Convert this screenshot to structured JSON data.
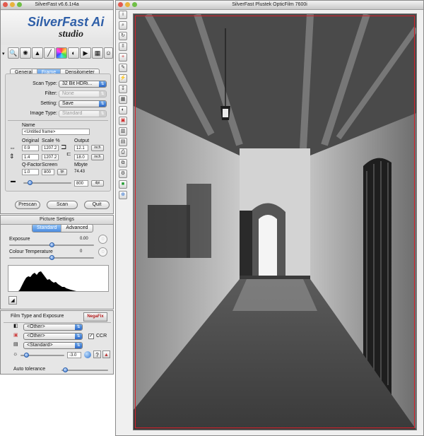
{
  "main_window": {
    "title": "SilverFast v6.6.1r4a",
    "brand_line1": "SilverFast Ai",
    "brand_line2": "studio",
    "tabs": [
      {
        "label": "General"
      },
      {
        "label": "Frame"
      },
      {
        "label": "Densitometer"
      }
    ],
    "scan_type": {
      "label": "Scan Type:",
      "value": "32 Bit HDRi..."
    },
    "filter": {
      "label": "Filter:",
      "value": "None"
    },
    "setting": {
      "label": "Setting:",
      "value": "Save"
    },
    "image_type": {
      "label": "Image Type:",
      "value": "Standard"
    },
    "name": {
      "label": "Name",
      "value": "<Untitled frame>"
    },
    "columns": {
      "original": "Original",
      "scale": "Scale %",
      "output": "Output"
    },
    "width_row": {
      "original": "0.9",
      "scale": "1207.2",
      "output": "12.1",
      "unit": "inch"
    },
    "height_row": {
      "original": "1.4",
      "scale": "1207.2",
      "output": "18.0",
      "unit": "inch"
    },
    "qfactor": {
      "label": "Q-Factor",
      "value": "1.0"
    },
    "screen": {
      "label": "Screen",
      "value": "800",
      "unit": "lpi"
    },
    "mbyte": {
      "label": "Mbyte",
      "value": "74.43"
    },
    "resolution": {
      "value": "800",
      "unit": "dpi"
    },
    "buttons": {
      "prescan": "Prescan",
      "scan": "Scan",
      "quit": "Quit"
    }
  },
  "picture_settings": {
    "title": "Picture Settings",
    "tabs": [
      {
        "label": "Standard"
      },
      {
        "label": "Advanced"
      }
    ],
    "exposure": {
      "label": "Exposure",
      "value": "0.00",
      "level": 0.5
    },
    "colour_temperature": {
      "label": "Colour Temperature",
      "value": "0",
      "level": 0.5
    }
  },
  "film_type": {
    "title": "Film Type and Exposure",
    "badge": "NegaFix",
    "manufacturer": "<Other>",
    "film": "<Other>",
    "type": "<Standard>",
    "ccr_label": "CCR",
    "ccr_checked": true,
    "exposure_value": "-3.0",
    "auto_tolerance": {
      "label": "Auto tolerance",
      "level": 0.18
    }
  },
  "preview_window": {
    "title": "SilverFast Plustek OpticFilm 7600i",
    "photo_description_hidden": ""
  },
  "colors": {
    "accent": "#3b7ad4",
    "selection_frame": "#d8202a",
    "window_bg": "#e6e6e6"
  }
}
